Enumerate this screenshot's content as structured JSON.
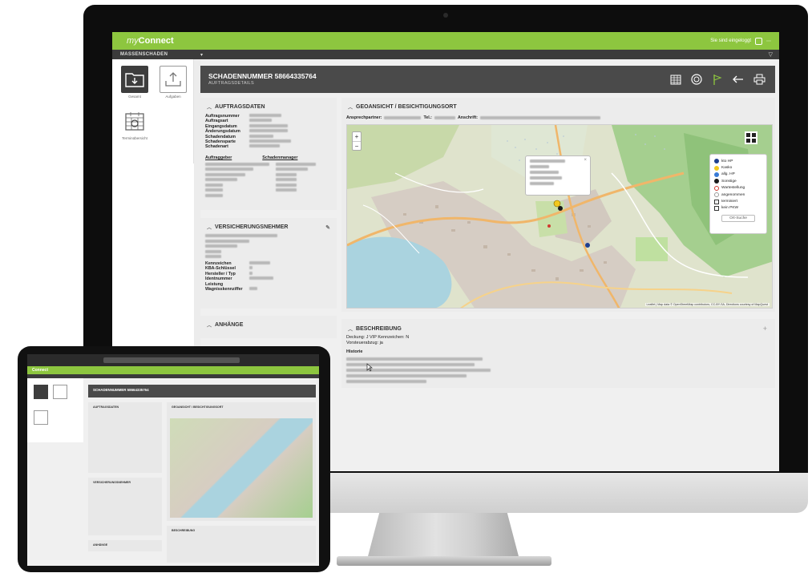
{
  "app": {
    "logo_prefix": "my",
    "logo_name": "Connect"
  },
  "user": {
    "status_text": "Sie sind eingeloggt"
  },
  "subbar": {
    "breadcrumb": "MASSENSCHADEN",
    "caret": "▾",
    "filter": "▽"
  },
  "nav": {
    "items": [
      {
        "label": "Gesamt",
        "icon": "folder-download-icon",
        "active": true
      },
      {
        "label": "Aufgaben",
        "icon": "upload-icon",
        "active": false
      },
      {
        "label": "Terminübersicht",
        "icon": "calendar-icon",
        "active": false
      }
    ]
  },
  "claim": {
    "title": "SCHADENNUMMER 58664335764",
    "subtitle": "AUFTRAGSDETAILS"
  },
  "header_icons": [
    "calendar-icon",
    "globe-icon",
    "flag-icon",
    "back-arrow-icon",
    "printer-icon"
  ],
  "auftragsdaten": {
    "title": "AUFTRAGSDATEN",
    "fields": [
      "Auftragsnummer",
      "Auftragsart",
      "Eingangsdatum",
      "Änderungsdatum",
      "Schadendatum",
      "Schadensparte",
      "Schadenart"
    ],
    "auftraggeber": "Auftraggeber",
    "schadenmanager": "Schadenmanager"
  },
  "versicherungsnehmer": {
    "title": "VERSICHERUNGSNEHMER",
    "fields": [
      "Kennzeichen",
      "KBA-Schlüssel",
      "Hersteller / Typ",
      "Identnummer",
      "Leistung",
      "Wagnisskennziffer"
    ]
  },
  "anhaenge": {
    "title": "ANHÄNGE"
  },
  "geo": {
    "title": "GEOANSICHT / BESICHTIGUNGSORT",
    "ansprech_label": "Ansprechpartner:",
    "tel_label": "Tel.:",
    "anschrift_label": "Anschrift:",
    "zoom_in": "+",
    "zoom_out": "−",
    "attribution": "Leaflet | Map data © OpenStreetMap contributors, CC-BY-SA, Directions courtesy of MapQuest",
    "legend": [
      {
        "label": "kto HP",
        "color": "#1f3f8f"
      },
      {
        "label": "Kasko",
        "color": "#f2c81e"
      },
      {
        "label": "allg. HP",
        "color": "#3a7bd5"
      },
      {
        "label": "Sonstige",
        "color": "#1a1a1a"
      },
      {
        "label": "Wartestellung",
        "color": "#d03a2f"
      },
      {
        "label": "angenommen",
        "color": "#f5f5f5"
      },
      {
        "label": "terminiert",
        "color": "#ffffff"
      },
      {
        "label": "kein PKW",
        "color": "#ffffff"
      }
    ],
    "search_button": "Ort-Suche"
  },
  "beschreibung": {
    "title": "BESCHREIBUNG",
    "line1": "Deckung: J VIP Kennzeichen: N",
    "line2": "Vorsteuerabzug: ja",
    "historie": "Historie",
    "add": "+"
  },
  "colors": {
    "brand_green": "#8dc63f",
    "header_dark": "#4a4a4a"
  }
}
